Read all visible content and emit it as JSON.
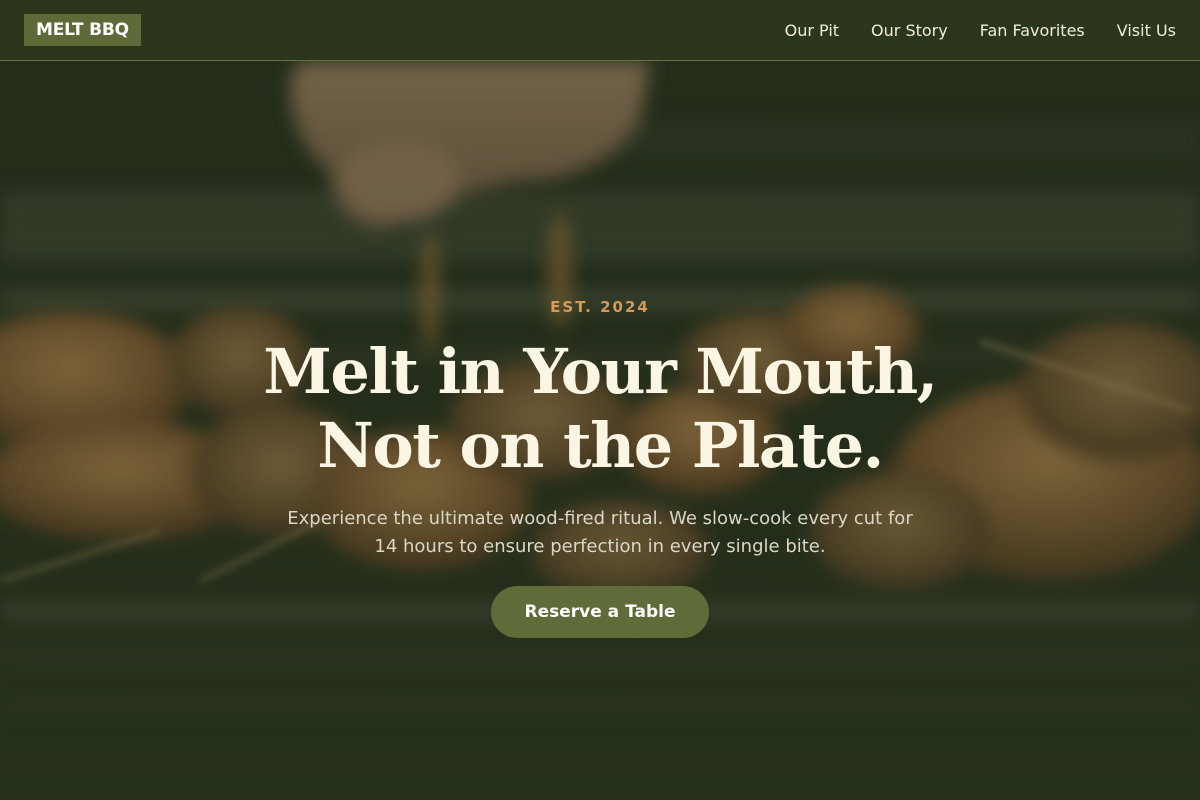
{
  "header": {
    "logo": "MELT BBQ",
    "nav": [
      "Our Pit",
      "Our Story",
      "Fan Favorites",
      "Visit Us"
    ]
  },
  "hero": {
    "background_image": "blurred-grill-skewers-photo",
    "eyebrow": "EST. 2024",
    "headline_line1": "Melt in Your Mouth,",
    "headline_line2": "Not on the Plate.",
    "subtext_line1": "Experience the ultimate wood-fired ritual. We slow-cook every cut for",
    "subtext_line2": "14 hours to ensure perfection in every single bite.",
    "cta": "Reserve a Table"
  },
  "colors": {
    "header_bg": "#2b361b",
    "logo_bg": "#5d6a37",
    "eyebrow": "#d39a58",
    "headline": "#fbf5e4",
    "cta_bg": "#606b3a"
  }
}
